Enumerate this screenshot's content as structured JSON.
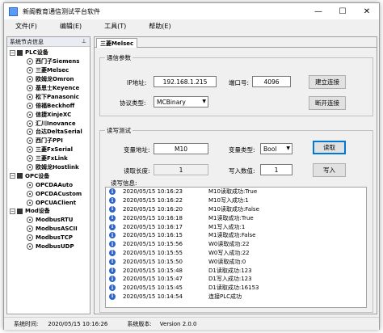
{
  "window": {
    "title": "新阁教育通信测试平台软件",
    "controls": [
      "—",
      "☐",
      "✕"
    ]
  },
  "menu": [
    "文件(F)",
    "编辑(E)",
    "工具(T)",
    "帮助(E)"
  ],
  "sidebar": {
    "title": "系统节点信息",
    "pin": "⊥",
    "groups": [
      {
        "label": "PLC设备",
        "expander": "−",
        "items": [
          "西门子Siemens",
          "三菱Melsec",
          "欧姆龙Omron",
          "基恩士Keyence",
          "松下Panasonic",
          "倍福Beckhoff",
          "信捷XinjeXC",
          "汇川Inovance",
          "台达DeltaSerial",
          "西门子PPI",
          "三菱FxSerial",
          "三菱FxLink",
          "欧姆龙Hostlink"
        ]
      },
      {
        "label": "OPC设备",
        "expander": "−",
        "items": [
          "OPCDAAuto",
          "OPCDACustom",
          "OPCUAClient"
        ]
      },
      {
        "label": "Mod设备",
        "expander": "−",
        "items": [
          "ModbusRTU",
          "ModbusASCII",
          "ModbusTCP",
          "ModbusUDP"
        ]
      }
    ]
  },
  "tab": {
    "label": "三菱Melsec"
  },
  "comm": {
    "legend": "通信参数",
    "ip_label": "IP地址:",
    "ip_value": "192.168.1.215",
    "port_label": "端口号:",
    "port_value": "4096",
    "connect_button": "建立连接",
    "protocol_label": "协议类型:",
    "protocol_value": "MCBinary",
    "disconnect_button": "断开连接"
  },
  "rw": {
    "legend": "读写测试",
    "addr_label": "变量地址:",
    "addr_value": "M10",
    "type_label": "变量类型:",
    "type_value": "Bool",
    "read_button": "读取",
    "len_label": "读取长度:",
    "len_value": "1",
    "write_label": "写入数值:",
    "write_value": "1",
    "write_button": "写入",
    "log_label": "读写信息:"
  },
  "log": [
    {
      "time": "2020/05/15 10:16:23",
      "msg": "M10读取成功:True"
    },
    {
      "time": "2020/05/15 10:16:22",
      "msg": "M10写入成功:1"
    },
    {
      "time": "2020/05/15 10:16:20",
      "msg": "M10读取成功:False"
    },
    {
      "time": "2020/05/15 10:16:18",
      "msg": "M1读取成功:True"
    },
    {
      "time": "2020/05/15 10:16:17",
      "msg": "M1写入成功:1"
    },
    {
      "time": "2020/05/15 10:16:15",
      "msg": "M1读取成功:False"
    },
    {
      "time": "2020/05/15 10:15:56",
      "msg": "W0读取成功:22"
    },
    {
      "time": "2020/05/15 10:15:55",
      "msg": "W0写入成功:22"
    },
    {
      "time": "2020/05/15 10:15:50",
      "msg": "W0读取成功:0"
    },
    {
      "time": "2020/05/15 10:15:48",
      "msg": "D1读取成功:123"
    },
    {
      "time": "2020/05/15 10:15:47",
      "msg": "D1写入成功:123"
    },
    {
      "time": "2020/05/15 10:15:45",
      "msg": "D1读取成功:16153"
    },
    {
      "time": "2020/05/15 10:14:54",
      "msg": "连接PLC成功"
    }
  ],
  "status": {
    "time_label": "系统时间:",
    "time_value": "2020/05/15 10:16:26",
    "version_label": "系统版本:",
    "version_value": "Version 2.0.0"
  }
}
